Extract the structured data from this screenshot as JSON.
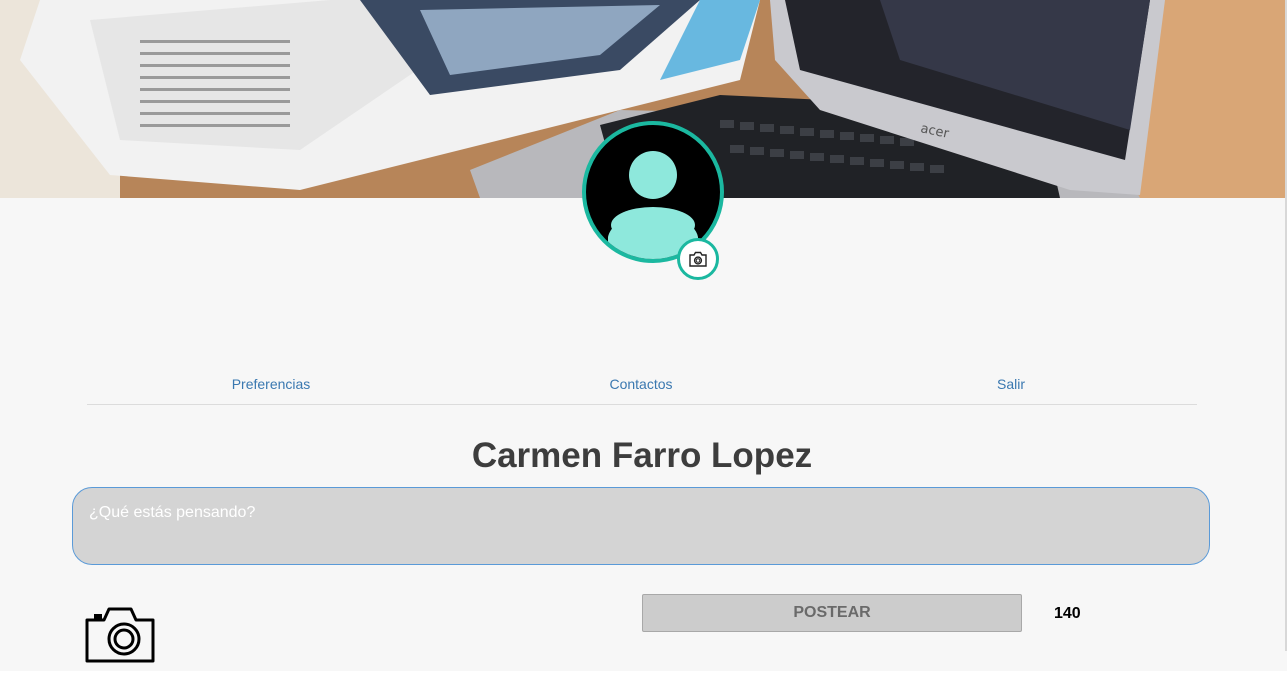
{
  "cover": {
    "image": "cover-photo-laptop-and-magazine",
    "laptop_brand": "acer"
  },
  "avatar": {
    "icon": "user-silhouette-icon",
    "border_color": "#1bb8a0",
    "icon_color": "#8ee8dc",
    "change_photo_icon": "camera-icon"
  },
  "nav": {
    "items": [
      {
        "label": "Preferencias"
      },
      {
        "label": "Contactos"
      },
      {
        "label": "Salir"
      }
    ],
    "link_color": "#3a78b0"
  },
  "profile": {
    "name": "Carmen Farro Lopez"
  },
  "composer": {
    "placeholder": "¿Qué estás pensando?",
    "value": "",
    "photo_icon": "camera-icon",
    "post_label": "POSTEAR",
    "char_count": "140"
  }
}
